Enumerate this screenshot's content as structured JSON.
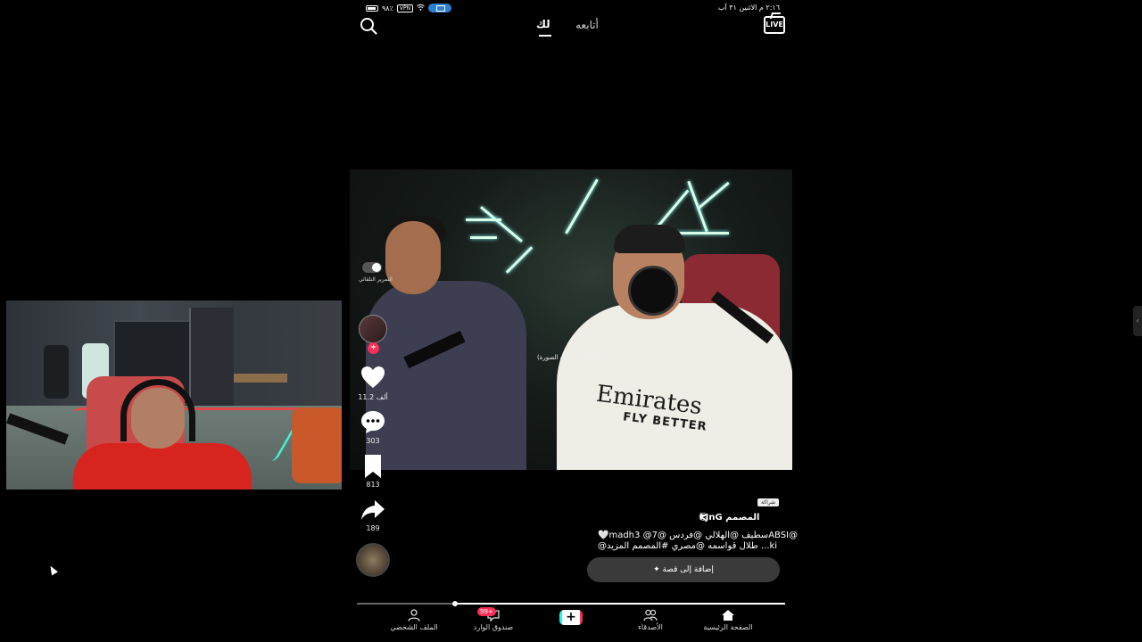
{
  "status_bar": {
    "battery": "٩٨٪",
    "vpn": "VPN",
    "datetime": "٢:١٦ م  الاثنين ٣١ آب"
  },
  "header": {
    "tab_for_you": "لك",
    "tab_following": "أتابعه",
    "live_label": "LIVE"
  },
  "video": {
    "autoscroll_label": "التمرير التلقائي",
    "photo_hint": "(ليست من هذه الصورة)",
    "shirt_brand": "Emirates",
    "shirt_sub": "FLY BETTER"
  },
  "actions": {
    "follow_badge": "+",
    "likes": "11.2 ألف",
    "comments": "303",
    "saves": "813",
    "shares": "189"
  },
  "caption": {
    "sponsor_tag": "شراكة",
    "author": "المصمم kJnG",
    "author_emoji": "😎",
    "line1": "🤍madhسطيف @الهلالي @فردس @7@ 3ABSI@",
    "line2": "@طلال قواسمه @مصري #المصمم المزيد ...ki"
  },
  "story_button": {
    "label": "✦  إضافة إلى قصة"
  },
  "progress": {
    "fraction": 0.77
  },
  "nav": {
    "home": "الصفحة الرئيسية",
    "friends": "الأصدقاء",
    "inbox": "صندوق الوارد",
    "inbox_badge": "99+",
    "profile": "الملف الشخصي"
  },
  "side_handle": "‹"
}
